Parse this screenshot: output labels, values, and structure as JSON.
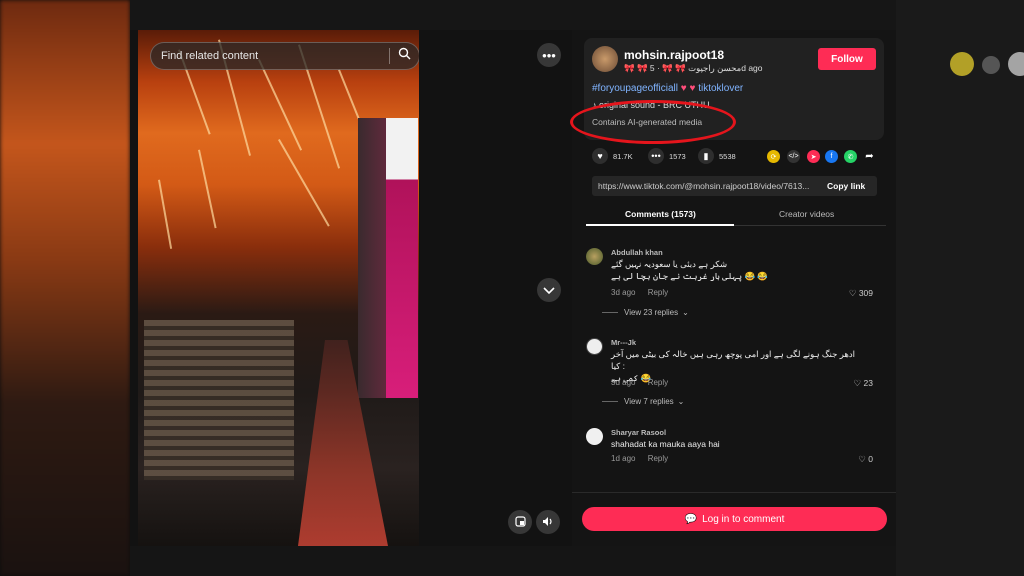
{
  "search": {
    "placeholder": "Find related content"
  },
  "post": {
    "username": "mohsin.rajpoot18",
    "display_name": "🎀 🎀 محسن راجپوت 🎀 🎀",
    "time_ago": "5d ago",
    "follow_label": "Follow",
    "hashtag_1": "#foryoupageofficiall",
    "hashtag_2": "tiktoklover",
    "sound": "original sound - BRC UTHU",
    "ai_label": "Contains AI-generated media"
  },
  "actions": {
    "likes": "81.7K",
    "comments": "1573",
    "saves": "5538"
  },
  "link": {
    "url": "https://www.tiktok.com/@mohsin.rajpoot18/video/7613...",
    "copy_label": "Copy link"
  },
  "tabs": {
    "comments": "Comments (1573)",
    "creator": "Creator videos"
  },
  "comments": [
    {
      "name": "Abdullah khan",
      "text_1": "شکر ہے دبئی یا سعودیہ نہیں گئے",
      "text_2": "پہلی بار غربت نے جان بچا لی ہے 😂 😂",
      "time": "3d ago",
      "reply": "Reply",
      "likes": "309",
      "view_replies": "View 23 replies"
    },
    {
      "name": "Mr---Jk",
      "text_1": "ادھر جنگ ہونے لگی ہے اور امی پوچھ رہی ہیں خالہ کی بیٹی میں آخر کیا :",
      "text_2": "کمی ہے 😂",
      "time": "3d ago",
      "reply": "Reply",
      "likes": "23",
      "view_replies": "View 7 replies"
    },
    {
      "name": "Sharyar Rasool",
      "text_1": "shahadat ka mauka aaya hai",
      "time": "1d ago",
      "reply": "Reply",
      "likes": "0"
    }
  ],
  "login_label": "Log in to comment",
  "colors": {
    "accent": "#fe2c55",
    "annotation": "#e5151c",
    "hashtag": "#80b4ff"
  }
}
